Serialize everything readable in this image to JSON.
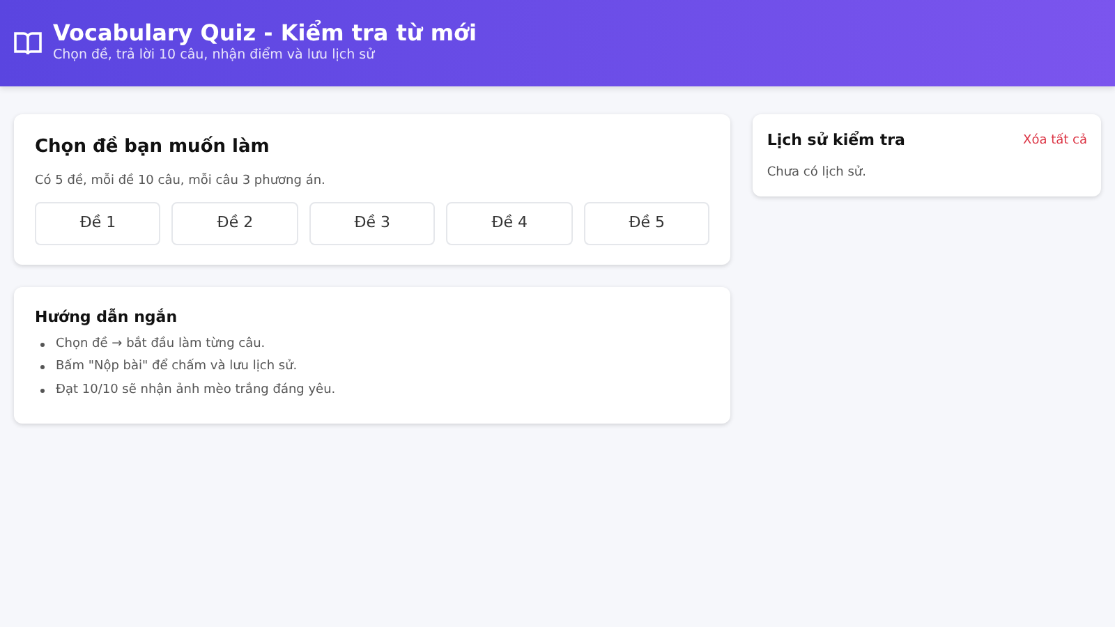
{
  "header": {
    "title": "Vocabulary Quiz - Kiểm tra từ mới",
    "subtitle": "Chọn đề, trả lời 10 câu, nhận điểm và lưu lịch sử"
  },
  "exam_picker": {
    "title": "Chọn đề bạn muốn làm",
    "description": "Có 5 đề, mỗi đề 10 câu, mỗi câu 3 phương án.",
    "exams": [
      "Đề 1",
      "Đề 2",
      "Đề 3",
      "Đề 4",
      "Đề 5"
    ]
  },
  "guide": {
    "title": "Hướng dẫn ngắn",
    "items": [
      "Chọn đề → bắt đầu làm từng câu.",
      "Bấm \"Nộp bài\" để chấm và lưu lịch sử.",
      "Đạt 10/10 sẽ nhận ảnh mèo trắng đáng yêu."
    ]
  },
  "history": {
    "title": "Lịch sử kiểm tra",
    "clear_link": "Xóa tất cả",
    "empty_text": "Chưa có lịch sử."
  }
}
